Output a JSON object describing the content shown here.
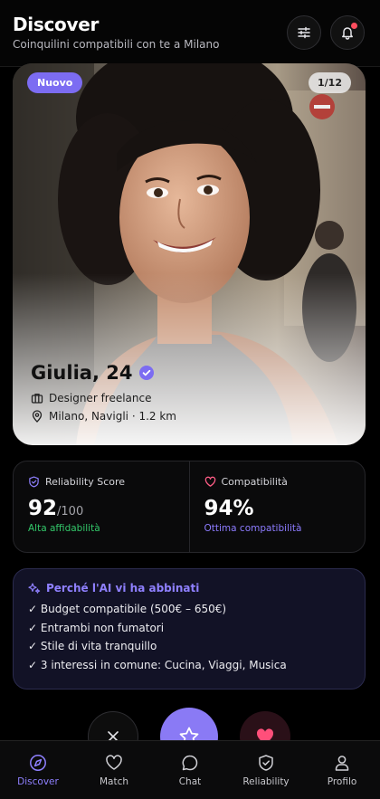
{
  "header": {
    "title": "Discover",
    "subtitle": "Coinquilini compatibili con te a Milano",
    "filter_icon": "sliders-icon",
    "bell_icon": "bell-icon"
  },
  "profile": {
    "badge": "Nuovo",
    "counter": "1/12",
    "name": "Giulia, 24",
    "job": "Designer freelance",
    "location": "Milano, Navigli · 1.2 km"
  },
  "scores": {
    "reliability": {
      "label": "Reliability Score",
      "value": "92",
      "suffix": "/100",
      "note": "Alta affidabilità"
    },
    "compatibility": {
      "label": "Compatibilità",
      "value": "94%",
      "note": "Ottima compatibilità"
    }
  },
  "ai_match": {
    "title": "Perché l'AI vi ha abbinati",
    "reasons": [
      "✓ Budget compatibile (500€ – 650€)",
      "✓ Entrambi non fumatori",
      "✓ Stile di vita tranquillo",
      "✓ 3 interessi in comune: Cucina, Viaggi, Musica"
    ]
  },
  "tabs": [
    {
      "label": "Discover",
      "icon": "compass-icon"
    },
    {
      "label": "Match",
      "icon": "heart-icon"
    },
    {
      "label": "Chat",
      "icon": "chat-bubble-icon"
    },
    {
      "label": "Reliability",
      "icon": "shield-check-icon"
    },
    {
      "label": "Profilo",
      "icon": "user-icon"
    }
  ],
  "colors": {
    "accent": "#8a7af5",
    "success": "#33c76a",
    "like": "#ff4f7a",
    "background": "#000000"
  }
}
